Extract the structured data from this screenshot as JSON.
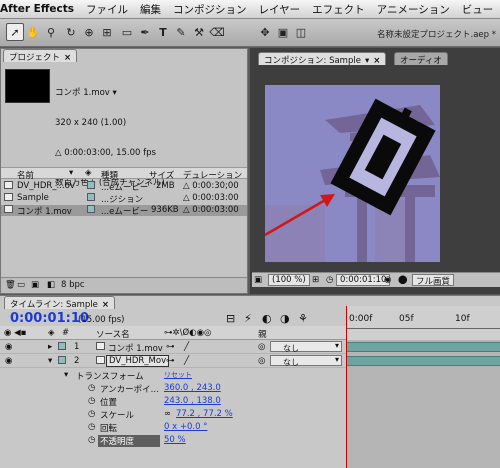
{
  "menubar": {
    "app": "After Effects",
    "items": [
      "ファイル",
      "編集",
      "コンポジション",
      "レイヤー",
      "エフェクト",
      "アニメーション",
      "ビュー"
    ]
  },
  "window_title": "名称未設定プロジェクト.aep *",
  "project_panel": {
    "tab": "プロジェクト",
    "selected_name": "コンポ 1.mov ▾",
    "info_lines": [
      "320 x 240 (1.00)",
      "△ 0:00:03:00, 15.00 fps",
      "数百万色+ (合成チャンネル)",
      "アニメーション"
    ],
    "columns": {
      "name": "名前",
      "type": "種類",
      "size": "サイズ",
      "duration": "デュレーション"
    },
    "rows": [
      {
        "name": "DV_HDR_...ov",
        "type": "...eムービー",
        "size": "2MB",
        "duration": "△ 0:00:30;00"
      },
      {
        "name": "Sample",
        "type": "...ジション",
        "size": "",
        "duration": "△ 0:00:03:00"
      },
      {
        "name": "コンポ 1.mov",
        "type": "...eムービー",
        "size": "936KB",
        "duration": "△ 0:00:03:00"
      }
    ],
    "bpc": "8 bpc"
  },
  "comp_panel": {
    "tab": "コンポジション: Sample",
    "tab2": "オーディオ",
    "zoom": "(100 %)",
    "time": "0:00:01:10",
    "quality": "フル画質"
  },
  "timeline": {
    "tab": "タイムライン: Sample",
    "time": "0:00:01:10",
    "fps": "(15.00 fps)",
    "col_source": "ソース名",
    "col_parent": "親",
    "layers": [
      {
        "num": "1",
        "name": "コンポ 1.mov",
        "parent": "なし"
      },
      {
        "num": "2",
        "name": "DV_HDR_Mov",
        "parent": "なし"
      }
    ],
    "transform_label": "トランスフォーム",
    "reset": "リセット",
    "props": [
      {
        "name": "アンカーポイ...",
        "value": "360.0 , 243.0"
      },
      {
        "name": "位置",
        "value": "243.0 , 138.0"
      },
      {
        "name": "スケール",
        "value": "77.2 , 77.2 %"
      },
      {
        "name": "回転",
        "value": "0 x +0.0 °"
      },
      {
        "name": "不透明度",
        "value": "50 %"
      }
    ],
    "ruler": [
      "0:00f",
      "05f",
      "10f"
    ]
  },
  "colors": {
    "accent": "#1a3bd6",
    "track": "#6fa5a0",
    "arrow": "#d01818"
  }
}
